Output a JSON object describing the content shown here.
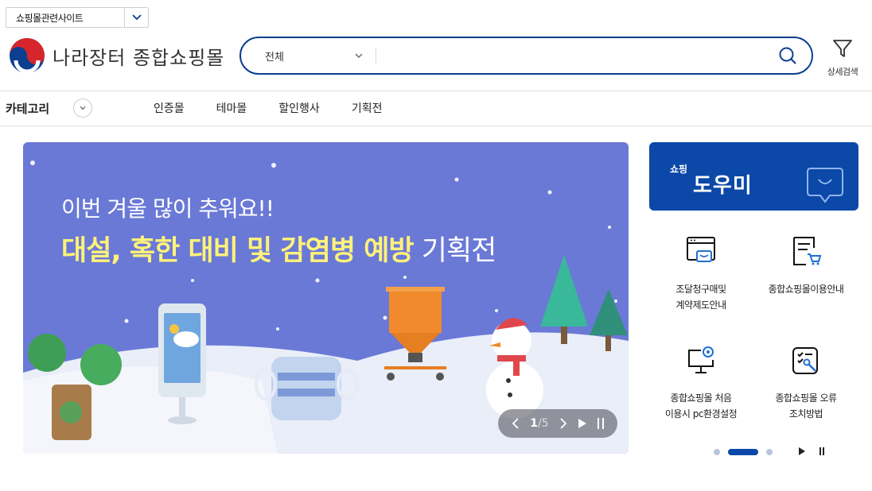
{
  "site_select": {
    "label": "쇼핑몰관련사이트"
  },
  "logo": {
    "name": "나라장터 종합쇼핑몰"
  },
  "search": {
    "category": "전체",
    "placeholder": ""
  },
  "detail_search": {
    "label": "상세검색"
  },
  "nav": {
    "category_label": "카테고리",
    "menu": [
      "인증몰",
      "테마몰",
      "할인행사",
      "기획전"
    ]
  },
  "banner": {
    "line1": "이번 겨울 많이 추워요!!",
    "line2_highlight": "대설, 혹한 대비 및 감염병 예방",
    "line2_rest": "기획전",
    "current": "1",
    "total": "/5"
  },
  "helper": {
    "small": "쇼핑",
    "big": "도우미",
    "items": [
      {
        "line1": "조달청구매및",
        "line2": "계약제도안내",
        "icon": "laptop-icon"
      },
      {
        "line1": "종합쇼핑몰이용안내",
        "line2": "",
        "icon": "document-cart-icon"
      },
      {
        "line1": "종합쇼핑몰 처음",
        "line2": "이용시 pc환경설정",
        "icon": "monitor-gear-icon"
      },
      {
        "line1": "종합쇼핑몰 오류",
        "line2": "조치방법",
        "icon": "clipboard-wrench-icon"
      }
    ]
  },
  "colors": {
    "brand": "#0b48a8",
    "search_border": "#0b3f8f",
    "banner_bg": "#6a79d6",
    "highlight": "#fff27a"
  }
}
